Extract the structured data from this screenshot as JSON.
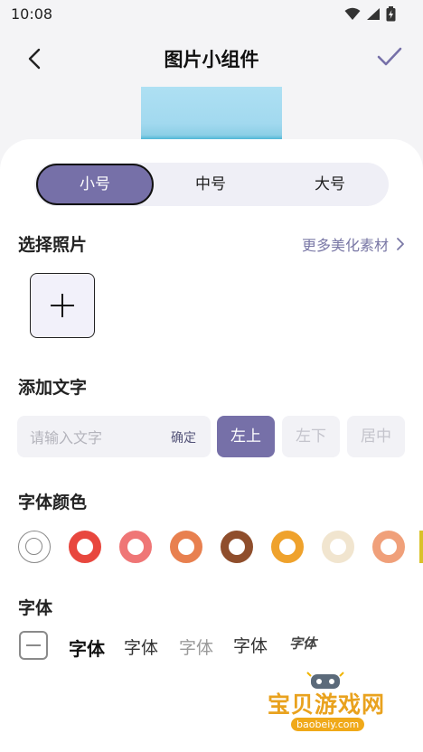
{
  "status_bar": {
    "time": "10:08",
    "icons": [
      "wifi-icon",
      "signal-icon",
      "battery-icon"
    ]
  },
  "header": {
    "title": "图片小组件",
    "back_icon": "chevron-left-icon",
    "confirm_icon": "check-icon"
  },
  "size_tabs": [
    {
      "label": "小号",
      "selected": true
    },
    {
      "label": "中号",
      "selected": false
    },
    {
      "label": "大号",
      "selected": false
    }
  ],
  "photo_section": {
    "title": "选择照片",
    "more_link": "更多美化素材",
    "add_icon": "plus-icon"
  },
  "text_section": {
    "title": "添加文字",
    "input_placeholder": "请输入文字",
    "input_value": "",
    "confirm_label": "确定",
    "positions": [
      {
        "label": "左上",
        "selected": true
      },
      {
        "label": "左下",
        "selected": false
      },
      {
        "label": "居中",
        "selected": false
      }
    ]
  },
  "color_section": {
    "title": "字体颜色",
    "colors": [
      "#ffffff",
      "#e8473e",
      "#ef7676",
      "#e8804f",
      "#8f4e2c",
      "#efa22c",
      "#f1e5cf",
      "#f0a07a"
    ]
  },
  "font_section": {
    "title": "字体",
    "options": [
      {
        "label": ""
      },
      {
        "label": "字体"
      },
      {
        "label": "字体"
      },
      {
        "label": "字体"
      },
      {
        "label": "字体"
      },
      {
        "label": "字体"
      }
    ]
  },
  "watermark": {
    "text": "宝贝游戏网",
    "sub": "baobeiy.com"
  }
}
